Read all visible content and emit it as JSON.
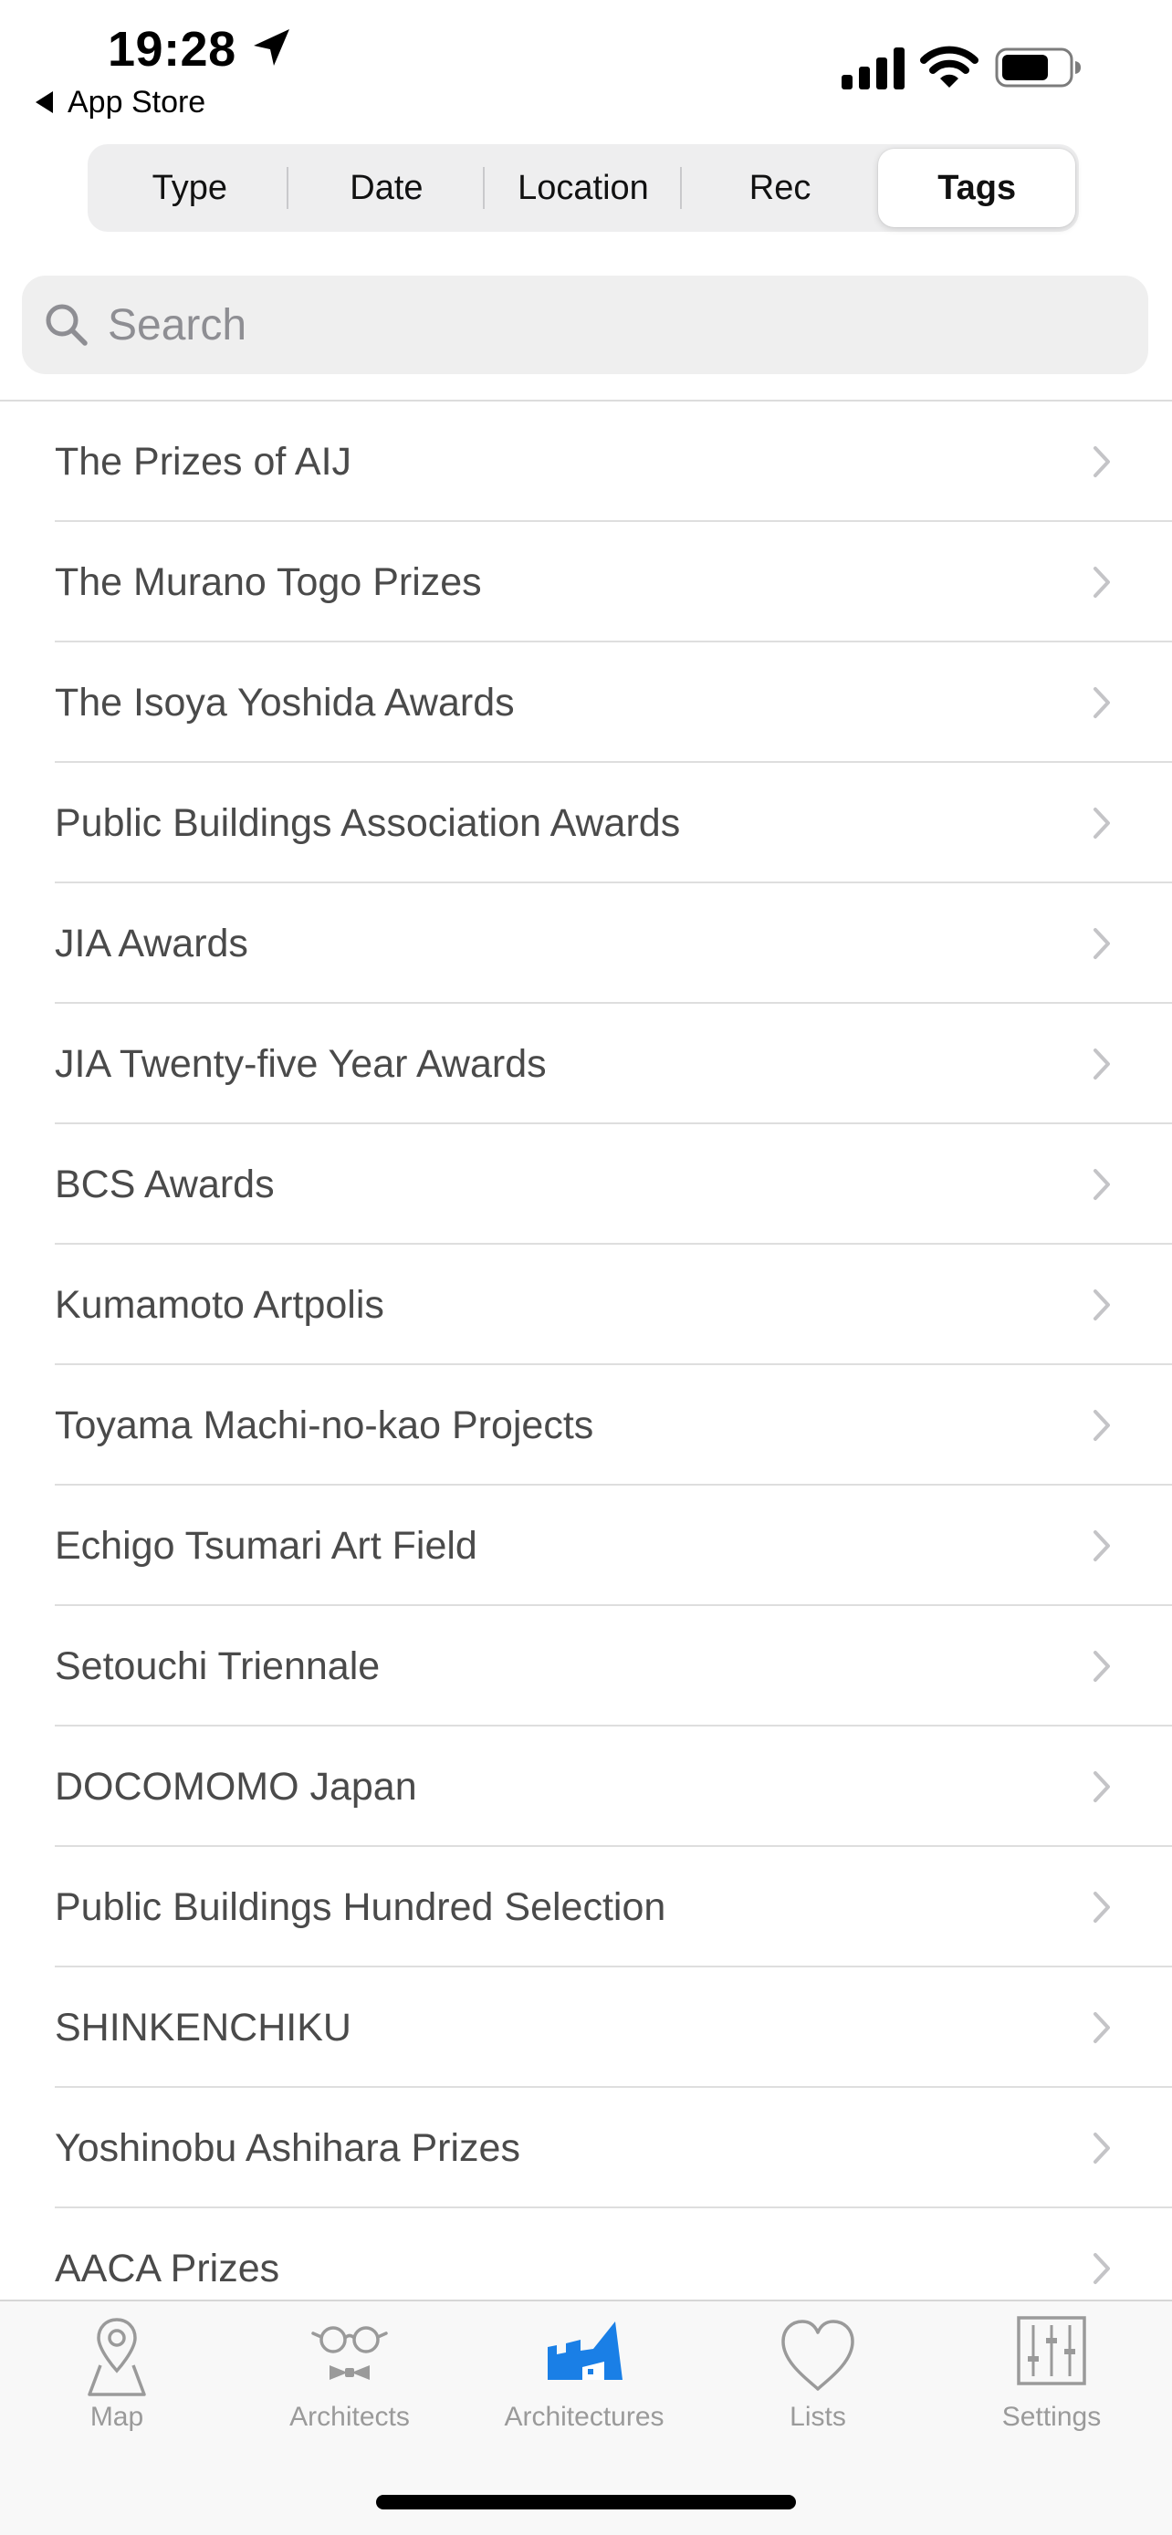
{
  "status_bar": {
    "time": "19:28",
    "back_label": "App Store"
  },
  "segments": [
    {
      "label": "Type",
      "selected": false
    },
    {
      "label": "Date",
      "selected": false
    },
    {
      "label": "Location",
      "selected": false
    },
    {
      "label": "Rec",
      "selected": false
    },
    {
      "label": "Tags",
      "selected": true
    }
  ],
  "search": {
    "placeholder": "Search",
    "value": ""
  },
  "tags": [
    "The Prizes of AIJ",
    "The Murano Togo Prizes",
    "The Isoya Yoshida Awards",
    "Public Buildings Association Awards",
    "JIA Awards",
    "JIA Twenty-five Year Awards",
    "BCS Awards",
    "Kumamoto Artpolis",
    "Toyama Machi-no-kao Projects",
    "Echigo Tsumari Art Field",
    "Setouchi Triennale",
    "DOCOMOMO Japan",
    "Public Buildings Hundred Selection",
    "SHINKENCHIKU",
    "Yoshinobu Ashihara Prizes",
    "AACA Prizes"
  ],
  "tab_bar": {
    "items": [
      {
        "label": "Map",
        "icon": "map-pin-icon",
        "active": false
      },
      {
        "label": "Architects",
        "icon": "glasses-bowtie-icon",
        "active": false
      },
      {
        "label": "Architectures",
        "icon": "building-icon",
        "active": true
      },
      {
        "label": "Lists",
        "icon": "heart-icon",
        "active": false
      },
      {
        "label": "Settings",
        "icon": "sliders-icon",
        "active": false
      }
    ]
  },
  "colors": {
    "accent": "#1a7fe6",
    "inactive": "#9a9a9a",
    "list_text": "#4a4a4a",
    "chevron": "#c4c4c7",
    "segment_bg": "#eeeeef",
    "search_bg": "#efefef"
  }
}
